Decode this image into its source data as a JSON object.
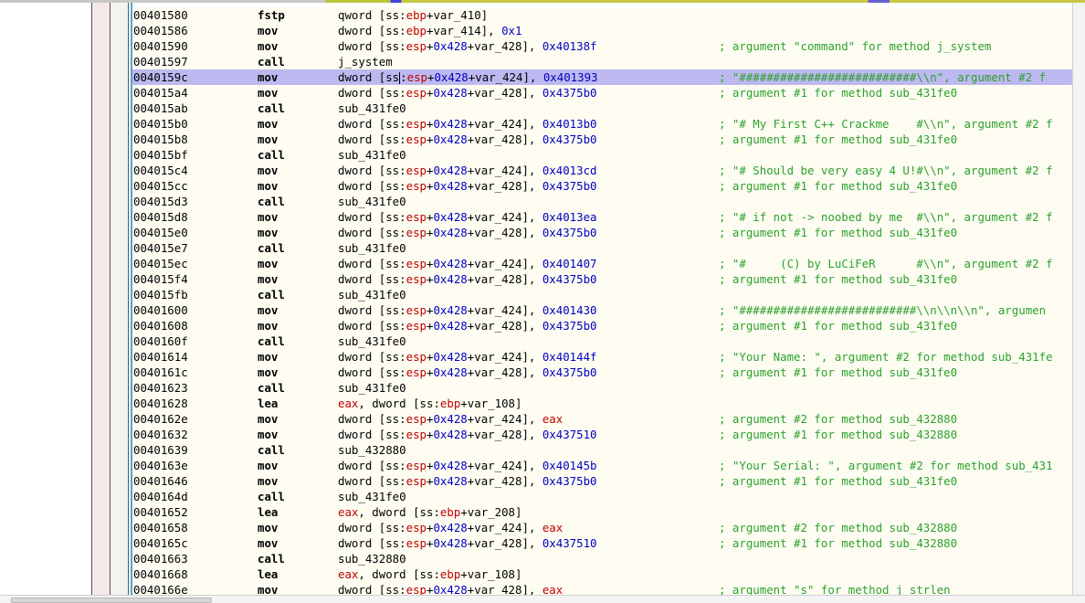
{
  "rows": [
    {
      "addr": "00401580",
      "mnem": "fstp",
      "ops": [
        [
          "qword [ss:",
          ""
        ],
        [
          "ebp",
          "reg"
        ],
        [
          "+var_410]",
          ""
        ]
      ],
      "cmt": ""
    },
    {
      "addr": "00401586",
      "mnem": "mov",
      "ops": [
        [
          "dword [ss:",
          ""
        ],
        [
          "ebp",
          "reg"
        ],
        [
          "+var_414], ",
          ""
        ],
        [
          "0x1",
          "num"
        ]
      ],
      "cmt": ""
    },
    {
      "addr": "00401590",
      "mnem": "mov",
      "ops": [
        [
          "dword [ss:",
          ""
        ],
        [
          "esp",
          "reg"
        ],
        [
          "+",
          ""
        ],
        [
          "0x428",
          "num"
        ],
        [
          "+var_428], ",
          ""
        ],
        [
          "0x40138f",
          "num"
        ]
      ],
      "cmt": "; argument \"command\" for method j_system"
    },
    {
      "addr": "00401597",
      "mnem": "call",
      "ops": [
        [
          "j_system",
          ""
        ]
      ],
      "cmt": ""
    },
    {
      "addr": "0040159c",
      "mnem": "mov",
      "selected": true,
      "ops": [
        [
          "dword [ss",
          ""
        ],
        [
          "|",
          "cursor"
        ],
        [
          ":",
          ""
        ],
        [
          "esp",
          "reg"
        ],
        [
          "+",
          ""
        ],
        [
          "0x428",
          "num"
        ],
        [
          "+var_424], ",
          ""
        ],
        [
          "0x401393",
          "num"
        ]
      ],
      "cmt": "; \"##########################\\\\n\", argument #2 f"
    },
    {
      "addr": "004015a4",
      "mnem": "mov",
      "ops": [
        [
          "dword [ss:",
          ""
        ],
        [
          "esp",
          "reg"
        ],
        [
          "+",
          ""
        ],
        [
          "0x428",
          "num"
        ],
        [
          "+var_428], ",
          ""
        ],
        [
          "0x4375b0",
          "num"
        ]
      ],
      "cmt": "; argument #1 for method sub_431fe0"
    },
    {
      "addr": "004015ab",
      "mnem": "call",
      "ops": [
        [
          "sub_431fe0",
          ""
        ]
      ],
      "cmt": ""
    },
    {
      "addr": "004015b0",
      "mnem": "mov",
      "ops": [
        [
          "dword [ss:",
          ""
        ],
        [
          "esp",
          "reg"
        ],
        [
          "+",
          ""
        ],
        [
          "0x428",
          "num"
        ],
        [
          "+var_424], ",
          ""
        ],
        [
          "0x4013b0",
          "num"
        ]
      ],
      "cmt": "; \"# My First C++ Crackme    #\\\\n\", argument #2 f"
    },
    {
      "addr": "004015b8",
      "mnem": "mov",
      "ops": [
        [
          "dword [ss:",
          ""
        ],
        [
          "esp",
          "reg"
        ],
        [
          "+",
          ""
        ],
        [
          "0x428",
          "num"
        ],
        [
          "+var_428], ",
          ""
        ],
        [
          "0x4375b0",
          "num"
        ]
      ],
      "cmt": "; argument #1 for method sub_431fe0"
    },
    {
      "addr": "004015bf",
      "mnem": "call",
      "ops": [
        [
          "sub_431fe0",
          ""
        ]
      ],
      "cmt": ""
    },
    {
      "addr": "004015c4",
      "mnem": "mov",
      "ops": [
        [
          "dword [ss:",
          ""
        ],
        [
          "esp",
          "reg"
        ],
        [
          "+",
          ""
        ],
        [
          "0x428",
          "num"
        ],
        [
          "+var_424], ",
          ""
        ],
        [
          "0x4013cd",
          "num"
        ]
      ],
      "cmt": "; \"# Should be very easy 4 U!#\\\\n\", argument #2 f"
    },
    {
      "addr": "004015cc",
      "mnem": "mov",
      "ops": [
        [
          "dword [ss:",
          ""
        ],
        [
          "esp",
          "reg"
        ],
        [
          "+",
          ""
        ],
        [
          "0x428",
          "num"
        ],
        [
          "+var_428], ",
          ""
        ],
        [
          "0x4375b0",
          "num"
        ]
      ],
      "cmt": "; argument #1 for method sub_431fe0"
    },
    {
      "addr": "004015d3",
      "mnem": "call",
      "ops": [
        [
          "sub_431fe0",
          ""
        ]
      ],
      "cmt": ""
    },
    {
      "addr": "004015d8",
      "mnem": "mov",
      "ops": [
        [
          "dword [ss:",
          ""
        ],
        [
          "esp",
          "reg"
        ],
        [
          "+",
          ""
        ],
        [
          "0x428",
          "num"
        ],
        [
          "+var_424], ",
          ""
        ],
        [
          "0x4013ea",
          "num"
        ]
      ],
      "cmt": "; \"# if not -> noobed by me  #\\\\n\", argument #2 f"
    },
    {
      "addr": "004015e0",
      "mnem": "mov",
      "ops": [
        [
          "dword [ss:",
          ""
        ],
        [
          "esp",
          "reg"
        ],
        [
          "+",
          ""
        ],
        [
          "0x428",
          "num"
        ],
        [
          "+var_428], ",
          ""
        ],
        [
          "0x4375b0",
          "num"
        ]
      ],
      "cmt": "; argument #1 for method sub_431fe0"
    },
    {
      "addr": "004015e7",
      "mnem": "call",
      "ops": [
        [
          "sub_431fe0",
          ""
        ]
      ],
      "cmt": ""
    },
    {
      "addr": "004015ec",
      "mnem": "mov",
      "ops": [
        [
          "dword [ss:",
          ""
        ],
        [
          "esp",
          "reg"
        ],
        [
          "+",
          ""
        ],
        [
          "0x428",
          "num"
        ],
        [
          "+var_424], ",
          ""
        ],
        [
          "0x401407",
          "num"
        ]
      ],
      "cmt": "; \"#     (C) by LuCiFeR      #\\\\n\", argument #2 f"
    },
    {
      "addr": "004015f4",
      "mnem": "mov",
      "ops": [
        [
          "dword [ss:",
          ""
        ],
        [
          "esp",
          "reg"
        ],
        [
          "+",
          ""
        ],
        [
          "0x428",
          "num"
        ],
        [
          "+var_428], ",
          ""
        ],
        [
          "0x4375b0",
          "num"
        ]
      ],
      "cmt": "; argument #1 for method sub_431fe0"
    },
    {
      "addr": "004015fb",
      "mnem": "call",
      "ops": [
        [
          "sub_431fe0",
          ""
        ]
      ],
      "cmt": ""
    },
    {
      "addr": "00401600",
      "mnem": "mov",
      "ops": [
        [
          "dword [ss:",
          ""
        ],
        [
          "esp",
          "reg"
        ],
        [
          "+",
          ""
        ],
        [
          "0x428",
          "num"
        ],
        [
          "+var_424], ",
          ""
        ],
        [
          "0x401430",
          "num"
        ]
      ],
      "cmt": "; \"##########################\\\\n\\\\n\\\\n\", argumen"
    },
    {
      "addr": "00401608",
      "mnem": "mov",
      "ops": [
        [
          "dword [ss:",
          ""
        ],
        [
          "esp",
          "reg"
        ],
        [
          "+",
          ""
        ],
        [
          "0x428",
          "num"
        ],
        [
          "+var_428], ",
          ""
        ],
        [
          "0x4375b0",
          "num"
        ]
      ],
      "cmt": "; argument #1 for method sub_431fe0"
    },
    {
      "addr": "0040160f",
      "mnem": "call",
      "ops": [
        [
          "sub_431fe0",
          ""
        ]
      ],
      "cmt": ""
    },
    {
      "addr": "00401614",
      "mnem": "mov",
      "ops": [
        [
          "dword [ss:",
          ""
        ],
        [
          "esp",
          "reg"
        ],
        [
          "+",
          ""
        ],
        [
          "0x428",
          "num"
        ],
        [
          "+var_424], ",
          ""
        ],
        [
          "0x40144f",
          "num"
        ]
      ],
      "cmt": "; \"Your Name: \", argument #2 for method sub_431fe"
    },
    {
      "addr": "0040161c",
      "mnem": "mov",
      "ops": [
        [
          "dword [ss:",
          ""
        ],
        [
          "esp",
          "reg"
        ],
        [
          "+",
          ""
        ],
        [
          "0x428",
          "num"
        ],
        [
          "+var_428], ",
          ""
        ],
        [
          "0x4375b0",
          "num"
        ]
      ],
      "cmt": "; argument #1 for method sub_431fe0"
    },
    {
      "addr": "00401623",
      "mnem": "call",
      "ops": [
        [
          "sub_431fe0",
          ""
        ]
      ],
      "cmt": ""
    },
    {
      "addr": "00401628",
      "mnem": "lea",
      "ops": [
        [
          "eax",
          "reg"
        ],
        [
          ", dword [ss:",
          ""
        ],
        [
          "ebp",
          "reg"
        ],
        [
          "+var_108]",
          ""
        ]
      ],
      "cmt": ""
    },
    {
      "addr": "0040162e",
      "mnem": "mov",
      "ops": [
        [
          "dword [ss:",
          ""
        ],
        [
          "esp",
          "reg"
        ],
        [
          "+",
          ""
        ],
        [
          "0x428",
          "num"
        ],
        [
          "+var_424], ",
          ""
        ],
        [
          "eax",
          "reg"
        ]
      ],
      "cmt": "; argument #2 for method sub_432880"
    },
    {
      "addr": "00401632",
      "mnem": "mov",
      "ops": [
        [
          "dword [ss:",
          ""
        ],
        [
          "esp",
          "reg"
        ],
        [
          "+",
          ""
        ],
        [
          "0x428",
          "num"
        ],
        [
          "+var_428], ",
          ""
        ],
        [
          "0x437510",
          "num"
        ]
      ],
      "cmt": "; argument #1 for method sub_432880"
    },
    {
      "addr": "00401639",
      "mnem": "call",
      "ops": [
        [
          "sub_432880",
          ""
        ]
      ],
      "cmt": ""
    },
    {
      "addr": "0040163e",
      "mnem": "mov",
      "ops": [
        [
          "dword [ss:",
          ""
        ],
        [
          "esp",
          "reg"
        ],
        [
          "+",
          ""
        ],
        [
          "0x428",
          "num"
        ],
        [
          "+var_424], ",
          ""
        ],
        [
          "0x40145b",
          "num"
        ]
      ],
      "cmt": "; \"Your Serial: \", argument #2 for method sub_431"
    },
    {
      "addr": "00401646",
      "mnem": "mov",
      "ops": [
        [
          "dword [ss:",
          ""
        ],
        [
          "esp",
          "reg"
        ],
        [
          "+",
          ""
        ],
        [
          "0x428",
          "num"
        ],
        [
          "+var_428], ",
          ""
        ],
        [
          "0x4375b0",
          "num"
        ]
      ],
      "cmt": "; argument #1 for method sub_431fe0"
    },
    {
      "addr": "0040164d",
      "mnem": "call",
      "ops": [
        [
          "sub_431fe0",
          ""
        ]
      ],
      "cmt": ""
    },
    {
      "addr": "00401652",
      "mnem": "lea",
      "ops": [
        [
          "eax",
          "reg"
        ],
        [
          ", dword [ss:",
          ""
        ],
        [
          "ebp",
          "reg"
        ],
        [
          "+var_208]",
          ""
        ]
      ],
      "cmt": ""
    },
    {
      "addr": "00401658",
      "mnem": "mov",
      "ops": [
        [
          "dword [ss:",
          ""
        ],
        [
          "esp",
          "reg"
        ],
        [
          "+",
          ""
        ],
        [
          "0x428",
          "num"
        ],
        [
          "+var_424], ",
          ""
        ],
        [
          "eax",
          "reg"
        ]
      ],
      "cmt": "; argument #2 for method sub_432880"
    },
    {
      "addr": "0040165c",
      "mnem": "mov",
      "ops": [
        [
          "dword [ss:",
          ""
        ],
        [
          "esp",
          "reg"
        ],
        [
          "+",
          ""
        ],
        [
          "0x428",
          "num"
        ],
        [
          "+var_428], ",
          ""
        ],
        [
          "0x437510",
          "num"
        ]
      ],
      "cmt": "; argument #1 for method sub_432880"
    },
    {
      "addr": "00401663",
      "mnem": "call",
      "ops": [
        [
          "sub_432880",
          ""
        ]
      ],
      "cmt": ""
    },
    {
      "addr": "00401668",
      "mnem": "lea",
      "ops": [
        [
          "eax",
          "reg"
        ],
        [
          ", dword [ss:",
          ""
        ],
        [
          "ebp",
          "reg"
        ],
        [
          "+var_108]",
          ""
        ]
      ],
      "cmt": ""
    },
    {
      "addr": "0040166e",
      "mnem": "mov",
      "ops": [
        [
          "dword [ss:",
          ""
        ],
        [
          "esp",
          "reg"
        ],
        [
          "+",
          ""
        ],
        [
          "0x428",
          "num"
        ],
        [
          "+var_428], ",
          ""
        ],
        [
          "eax",
          "reg"
        ]
      ],
      "cmt": "; argument \"s\" for method j_strlen"
    }
  ]
}
